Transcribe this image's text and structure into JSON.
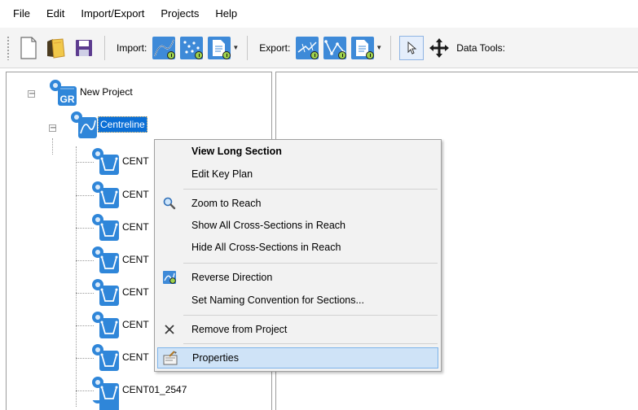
{
  "menubar": {
    "items": [
      "File",
      "Edit",
      "Import/Export",
      "Projects",
      "Help"
    ]
  },
  "toolbar": {
    "import_label": "Import:",
    "export_label": "Export:",
    "data_tools_label": "Data Tools:"
  },
  "tree": {
    "root_label": "New Project",
    "root_badge": "GR",
    "reach_label": "Centreline",
    "sections": [
      "CENT",
      "CENT",
      "CENT",
      "CENT",
      "CENT",
      "CENT",
      "CENT",
      "CENT01_2547"
    ]
  },
  "context_menu": {
    "items": [
      {
        "label": "View Long Section",
        "bold": true,
        "icon": ""
      },
      {
        "label": "Edit Key Plan",
        "bold": false,
        "icon": ""
      },
      {
        "label": "Zoom to Reach",
        "bold": false,
        "icon": "magnifier-icon"
      },
      {
        "label": "Show All Cross-Sections in Reach",
        "bold": false,
        "icon": ""
      },
      {
        "label": "Hide All Cross-Sections in Reach",
        "bold": false,
        "icon": ""
      },
      {
        "label": "Reverse Direction",
        "bold": false,
        "icon": "reverse-direction-icon"
      },
      {
        "label": "Set Naming Convention for Sections...",
        "bold": false,
        "icon": ""
      },
      {
        "label": "Remove from Project",
        "bold": false,
        "icon": "x-icon"
      },
      {
        "label": "Properties",
        "bold": false,
        "icon": "properties-icon",
        "highlighted": true
      }
    ]
  },
  "colors": {
    "selection_blue": "#0b6fd6",
    "menu_highlight": "#cfe3f7",
    "icon_blue": "#2f86d9"
  }
}
